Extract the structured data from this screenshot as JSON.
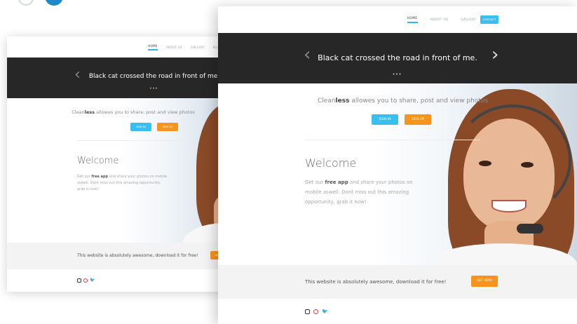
{
  "nav": {
    "items": [
      "Home",
      "About us",
      "Gallery",
      "Blog"
    ],
    "contact": "Contact"
  },
  "hero": {
    "title": "Black cat crossed the road in front of me.",
    "prev_arrow": "‹",
    "next_arrow": "›",
    "dots": "•••"
  },
  "intro": {
    "tag_prefix": "Clean",
    "tag_bold": "less",
    "tag_rest": " allowes you to share, post and view photos",
    "signin": "Sign in",
    "signup": "Sign up"
  },
  "welcome": {
    "title": "Welcome",
    "text_pre": "Get our ",
    "text_bold": "free app",
    "text_post": " and share your photos on mobile aswell. Dont miss out this amazing opportunity, grab it now!"
  },
  "footer": {
    "text": "This website is absolutely awesome, download it for free!",
    "cta": "Get now"
  },
  "colors": {
    "accent_blue": "#39bfef",
    "accent_orange": "#f7941d",
    "hero_bg": "#272727"
  },
  "icons": [
    "instagram-icon",
    "dribbble-icon",
    "twitter-icon"
  ]
}
